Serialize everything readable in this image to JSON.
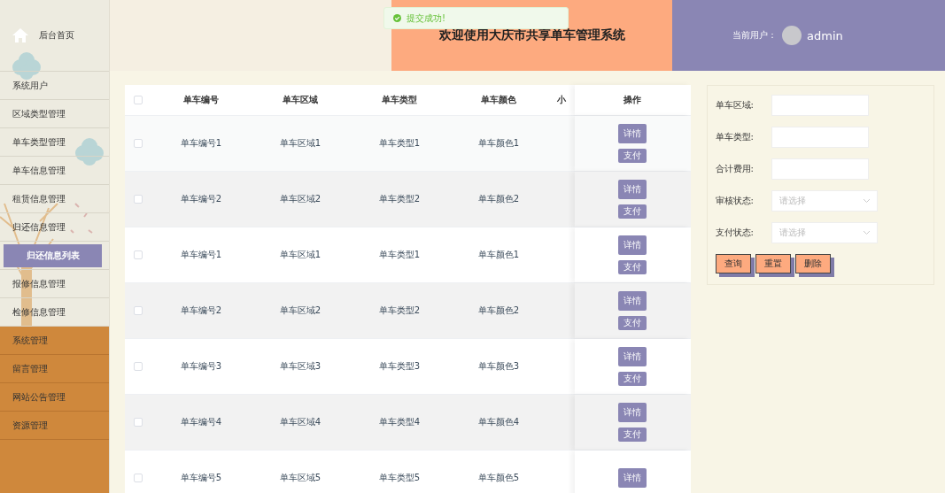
{
  "sidebar": {
    "home": {
      "label": "后台首页"
    },
    "items": [
      {
        "label": "系统用户",
        "kind": "menu",
        "selected": false
      },
      {
        "label": "区域类型管理",
        "kind": "menu",
        "selected": false
      },
      {
        "label": "单车类型管理",
        "kind": "menu",
        "selected": false
      },
      {
        "label": "单车信息管理",
        "kind": "menu",
        "selected": false
      },
      {
        "label": "租赁信息管理",
        "kind": "menu",
        "selected": false
      },
      {
        "label": "归还信息管理",
        "kind": "menu",
        "selected": false
      },
      {
        "label": "归还信息列表",
        "kind": "submenu",
        "selected": true
      },
      {
        "label": "报修信息管理",
        "kind": "menu",
        "selected": false
      },
      {
        "label": "检修信息管理",
        "kind": "menu",
        "selected": false
      },
      {
        "label": "系统管理",
        "kind": "system",
        "selected": false
      },
      {
        "label": "留言管理",
        "kind": "system",
        "selected": false
      },
      {
        "label": "网站公告管理",
        "kind": "system",
        "selected": false
      },
      {
        "label": "资源管理",
        "kind": "system",
        "selected": false
      }
    ]
  },
  "header": {
    "title": "欢迎使用大庆市共享单车管理系统",
    "user_label": "当前用户：",
    "user_name": "admin"
  },
  "toast": {
    "message": "提交成功!"
  },
  "table": {
    "all_checked": false,
    "columns": [
      "单车编号",
      "单车区域",
      "单车类型",
      "单车颜色",
      "小",
      "操作"
    ],
    "rows": [
      {
        "cells": [
          "单车编号1",
          "单车区域1",
          "单车类型1",
          "单车颜色1"
        ],
        "checked": false,
        "actions": [
          "详情",
          "支付"
        ]
      },
      {
        "cells": [
          "单车编号2",
          "单车区域2",
          "单车类型2",
          "单车颜色2"
        ],
        "checked": false,
        "actions": [
          "详情",
          "支付"
        ]
      },
      {
        "cells": [
          "单车编号1",
          "单车区域1",
          "单车类型1",
          "单车颜色1"
        ],
        "checked": false,
        "actions": [
          "详情",
          "支付"
        ]
      },
      {
        "cells": [
          "单车编号2",
          "单车区域2",
          "单车类型2",
          "单车颜色2"
        ],
        "checked": false,
        "actions": [
          "详情",
          "支付"
        ]
      },
      {
        "cells": [
          "单车编号3",
          "单车区域3",
          "单车类型3",
          "单车颜色3"
        ],
        "checked": false,
        "actions": [
          "详情",
          "支付"
        ]
      },
      {
        "cells": [
          "单车编号4",
          "单车区域4",
          "单车类型4",
          "单车颜色4"
        ],
        "checked": false,
        "actions": [
          "详情",
          "支付"
        ]
      },
      {
        "cells": [
          "单车编号5",
          "单车区域5",
          "单车类型5",
          "单车颜色5"
        ],
        "checked": false,
        "actions": [
          "详情"
        ]
      }
    ]
  },
  "search": {
    "fields": [
      {
        "label": "单车区域:",
        "kind": "input"
      },
      {
        "label": "单车类型:",
        "kind": "input"
      },
      {
        "label": "合计费用:",
        "kind": "input"
      },
      {
        "label": "审核状态:",
        "kind": "select",
        "placeholder": "请选择"
      },
      {
        "label": "支付状态:",
        "kind": "select",
        "placeholder": "请选择"
      }
    ],
    "buttons": [
      "查询",
      "重置",
      "删除"
    ]
  }
}
